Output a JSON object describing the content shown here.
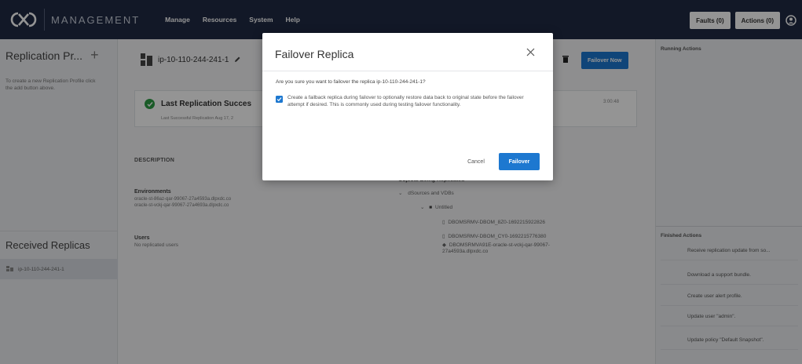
{
  "header": {
    "brand": "MANAGEMENT",
    "nav": [
      "Manage",
      "Resources",
      "System",
      "Help"
    ],
    "faults_label": "Faults (0)",
    "actions_label": "Actions (0)"
  },
  "sidebar": {
    "title": "Replication Pr...",
    "hint": "To create a new Replication Profile click the add button above.",
    "received_title": "Received Replicas",
    "received_items": [
      "ip-10-110-244-241-1"
    ]
  },
  "main": {
    "host": "ip-10-110-244-241-1",
    "failover_now_label": "Failover Now",
    "status": {
      "title": "Last Replication Succes",
      "subtitle": "Last Successful Replication Aug 17, 2",
      "time": "3:00:48"
    },
    "description_label": "DESCRIPTION",
    "environments_label": "Environments",
    "environments": [
      "oracle-st-86az-qar-99067-27a4593a.dlpxdc.co",
      "oracle-st-vckj-qar-99067-27a4693a.dlpxdc.co"
    ],
    "users_label": "Users",
    "users_value": "No replicated users",
    "objects_label": "Objects Being Replicated",
    "tree": {
      "root": "dSources and VDBs",
      "folder": "Untitled",
      "items": [
        "DBOMSRMV-DBOM_8Z0-1692215922826",
        "DBOMSRMV-DBOM_CY0-1692215776380",
        "DBOMSRMVA91E-oracle-st-vckj-qar-99067-",
        "27a4593a.dlpxdc.co"
      ]
    }
  },
  "right_panel": {
    "running_title": "Running Actions",
    "finished_title": "Finished Actions",
    "finished_items": [
      "Receive replication update from so...",
      "Download a support bundle.",
      "Create user alert profile.",
      "Update user \"admin\".",
      "Update policy \"Default Snapshot\"."
    ]
  },
  "modal": {
    "title": "Failover Replica",
    "question": "Are you sure you want to failover the replica ip-10-110-244-241-1?",
    "checkbox_checked": true,
    "checkbox_text": "Create a failback replica during failover to optionally restore data back to original state before the failover attempt if desired. This is commonly used during testing failover functionality.",
    "cancel_label": "Cancel",
    "failover_label": "Failover"
  },
  "colors": {
    "nav_bg": "#202a44",
    "accent": "#1d78d0",
    "success": "#2e9e45"
  }
}
